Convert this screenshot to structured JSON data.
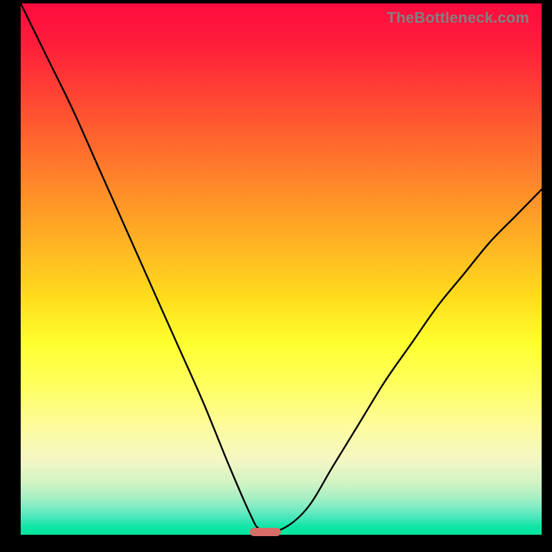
{
  "watermark": "TheBottleneck.com",
  "colors": {
    "background": "#000000",
    "gradient_top": "#ff0b3f",
    "gradient_mid": "#ffff30",
    "gradient_bottom": "#00e69a",
    "curve": "#000000",
    "marker": "#d96c66",
    "watermark": "#808080"
  },
  "chart_data": {
    "type": "line",
    "title": "",
    "xlabel": "",
    "ylabel": "",
    "xlim": [
      0,
      100
    ],
    "ylim": [
      0,
      100
    ],
    "series": [
      {
        "name": "bottleneck-curve",
        "x": [
          0,
          5,
          10,
          15,
          20,
          25,
          30,
          35,
          40,
          44,
          46,
          50,
          55,
          60,
          65,
          70,
          75,
          80,
          85,
          90,
          95,
          100
        ],
        "values": [
          100,
          90,
          80,
          69,
          58,
          47,
          36,
          25,
          13,
          4,
          1,
          1,
          5,
          13,
          21,
          29,
          36,
          43,
          49,
          55,
          60,
          65
        ]
      }
    ],
    "annotations": [
      {
        "name": "minimum-marker",
        "x_start": 44,
        "x_end": 50,
        "y": 0.5
      }
    ]
  }
}
